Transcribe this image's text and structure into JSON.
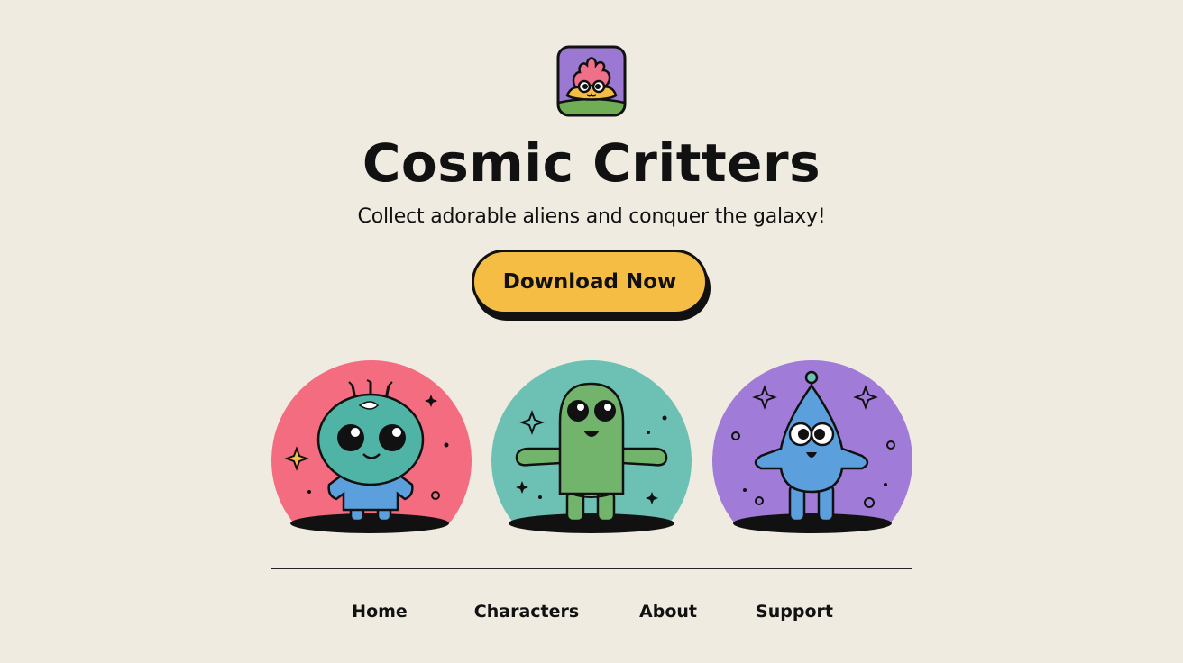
{
  "app": {
    "icon": "alien-app-icon",
    "title": "Cosmic Critters",
    "tagline": "Collect adorable aliens and conquer the galaxy!"
  },
  "cta": {
    "label": "Download Now",
    "color": "#f6bd45"
  },
  "critters": [
    {
      "icon": "teal-antenna-alien-icon",
      "bg_color": "#f36c80",
      "body_color": "#4fb3a5"
    },
    {
      "icon": "green-blob-alien-icon",
      "bg_color": "#6cc1b4",
      "body_color": "#72b46b"
    },
    {
      "icon": "blue-cone-alien-icon",
      "bg_color": "#a07bd8",
      "body_color": "#5b9fdc"
    }
  ],
  "nav": {
    "items": [
      {
        "label": "Home"
      },
      {
        "label": "Characters"
      },
      {
        "label": "About"
      },
      {
        "label": "Support"
      }
    ]
  },
  "colors": {
    "background": "#f0ebe0",
    "accent": "#f6bd45",
    "ink": "#111111"
  }
}
